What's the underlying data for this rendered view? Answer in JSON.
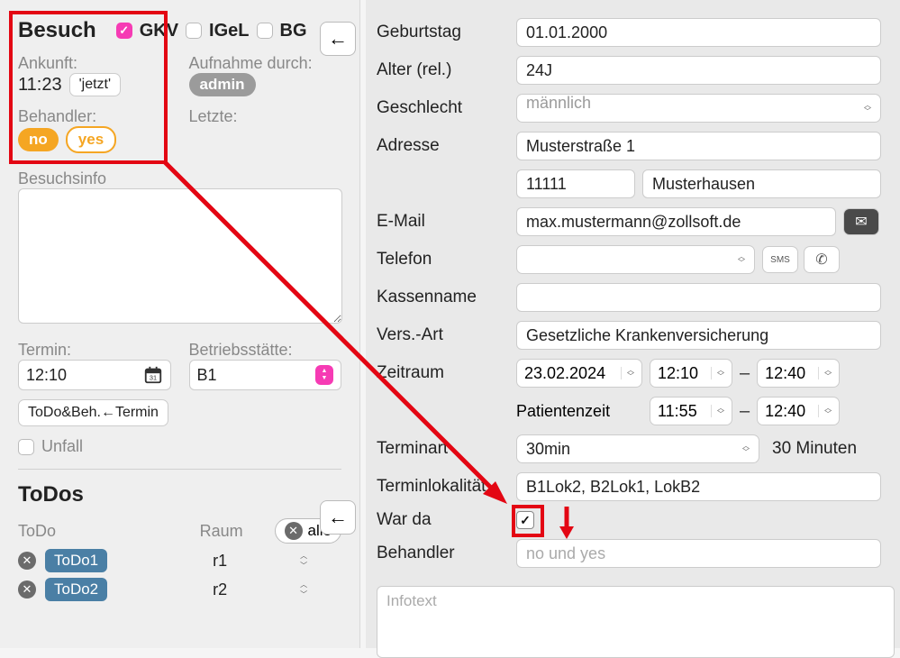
{
  "left": {
    "title": "Besuch",
    "chk_gkv": "GKV",
    "chk_igel": "IGeL",
    "chk_bg": "BG",
    "arrival_label": "Ankunft:",
    "arrival_time": "11:23",
    "now_btn": "'jetzt'",
    "aufnahme_label": "Aufnahme durch:",
    "aufnahme_val": "admin",
    "behandler_label": "Behandler:",
    "letzte_label": "Letzte:",
    "behandler_no": "no",
    "behandler_yes": "yes",
    "besuchsinfo_label": "Besuchsinfo",
    "termin_label": "Termin:",
    "termin_time": "12:10",
    "betrieb_label": "Betriebsstätte:",
    "betrieb_val": "B1",
    "todo_termin_btn": "ToDo&Beh.←Termin",
    "unfall_label": "Unfall",
    "todos_title": "ToDos",
    "todo_col": "ToDo",
    "raum_col": "Raum",
    "alle_btn": "alle",
    "todo1": "ToDo1",
    "todo2": "ToDo2",
    "raum1": "r1",
    "raum2": "r2"
  },
  "right": {
    "birthday_label": "Geburtstag",
    "birthday_val": "01.01.2000",
    "alter_label": "Alter (rel.)",
    "alter_val": "24J",
    "geschlecht_label": "Geschlecht",
    "geschlecht_val": "männlich",
    "adresse_label": "Adresse",
    "adresse_str": "Musterstraße 1",
    "adresse_plz": "11111",
    "adresse_ort": "Musterhausen",
    "email_label": "E-Mail",
    "email_val": "max.mustermann@zollsoft.de",
    "telefon_label": "Telefon",
    "kasse_label": "Kassenname",
    "versart_label": "Vers.-Art",
    "versart_val": "Gesetzliche Krankenversicherung",
    "zeitraum_label": "Zeitraum",
    "zeitraum_date": "23.02.2024",
    "zeitraum_from": "12:10",
    "zeitraum_to": "12:40",
    "patientenzeit_label": "Patientenzeit",
    "patientenzeit_from": "11:55",
    "patientenzeit_to": "12:40",
    "terminart_label": "Terminart",
    "terminart_val": "30min",
    "terminart_dur": "30 Minuten",
    "terminlok_label": "Terminlokalität",
    "terminlok_val": "B1Lok2, B2Lok1, LokB2",
    "warda_label": "War da",
    "behandler_label": "Behandler",
    "behandler_val": "no und yes",
    "infotext_placeholder": "Infotext"
  }
}
